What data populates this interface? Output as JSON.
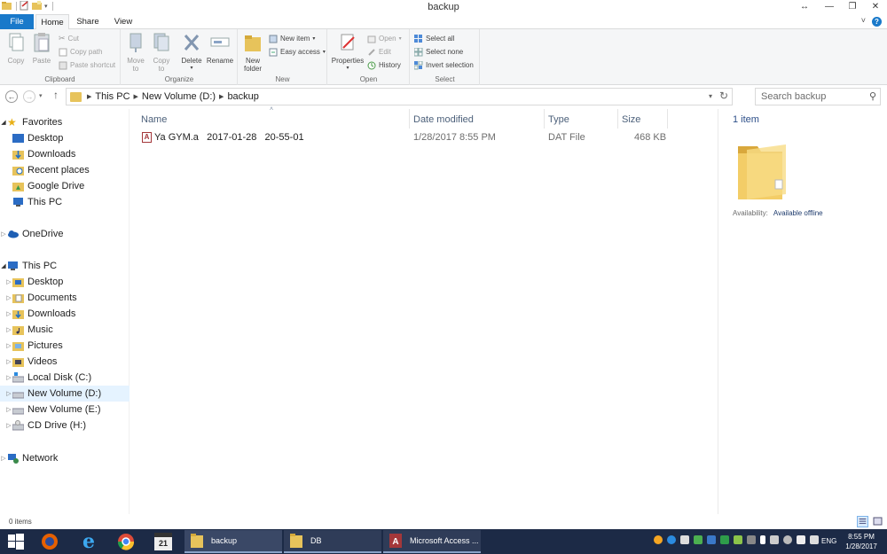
{
  "window": {
    "title": "backup"
  },
  "ribbon_tabs": [
    "File",
    "Home",
    "Share",
    "View"
  ],
  "clipboard": {
    "copy": "Copy",
    "paste": "Paste",
    "cut": "Cut",
    "copy_path": "Copy path",
    "paste_shortcut": "Paste shortcut",
    "label": "Clipboard"
  },
  "organize": {
    "move_to": "Move",
    "move_to2": "to",
    "copy_to": "Copy",
    "copy_to2": "to",
    "delete": "Delete",
    "rename": "Rename",
    "label": "Organize"
  },
  "new": {
    "new_folder": "New",
    "new_folder2": "folder",
    "new_item": "New item",
    "easy_access": "Easy access",
    "label": "New"
  },
  "open": {
    "properties": "Properties",
    "open": "Open",
    "edit": "Edit",
    "history": "History",
    "label": "Open"
  },
  "select": {
    "select_all": "Select all",
    "select_none": "Select none",
    "invert": "Invert selection",
    "label": "Select"
  },
  "address": {
    "crumbs": [
      "This PC",
      "New Volume (D:)",
      "backup"
    ],
    "search_placeholder": "Search backup"
  },
  "nav": {
    "favorites": "Favorites",
    "fav_items": [
      "Desktop",
      "Downloads",
      "Recent places",
      "Google Drive",
      "This PC"
    ],
    "onedrive": "OneDrive",
    "thispc": "This PC",
    "pc_items": [
      "Desktop",
      "Documents",
      "Downloads",
      "Music",
      "Pictures",
      "Videos",
      "Local Disk (C:)",
      "New Volume (D:)",
      "New Volume (E:)",
      "CD Drive (H:)"
    ],
    "network": "Network"
  },
  "columns": {
    "name": "Name",
    "date": "Date modified",
    "type": "Type",
    "size": "Size"
  },
  "files": [
    {
      "name": "Ya GYM.a   2017-01-28   20-55-01",
      "date": "1/28/2017 8:55 PM",
      "type": "DAT File",
      "size": "468 KB"
    }
  ],
  "details": {
    "count": "1 item",
    "availability_label": "Availability:",
    "availability_value": "Available offline"
  },
  "status": {
    "items": "0 items"
  },
  "taskbar": {
    "apps": [
      "backup",
      "DB",
      "Microsoft Access ..."
    ],
    "lang": "ENG",
    "time": "8:55 PM",
    "date": "1/28/2017",
    "calendar_day": "21"
  },
  "colors": {
    "accent": "#1979ca",
    "folder": "#e7c35b",
    "taskbar": "#1c2a46"
  }
}
